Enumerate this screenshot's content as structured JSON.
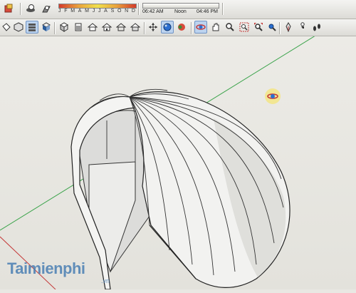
{
  "toolbar_shadows": {
    "months": [
      "J",
      "F",
      "M",
      "A",
      "M",
      "J",
      "J",
      "A",
      "S",
      "O",
      "N",
      "D"
    ],
    "time_start": "06:42 AM",
    "time_mid": "Noon",
    "time_end": "04:46 PM"
  },
  "toolbar_views": {
    "buttons": [
      "paint-bucket-icon",
      "iso-view-icon",
      "top-view-icon",
      "front-view-icon",
      "right-view-icon",
      "back-view-icon",
      "left-view-icon",
      "house-icon",
      "xray-icon",
      "wireframe-icon",
      "hidden-line-icon",
      "shaded-icon",
      "textured-icon",
      "orbit-icon",
      "pan-icon",
      "zoom-icon",
      "zoom-window-icon",
      "zoom-extents-icon",
      "previous-view-icon",
      "position-camera-icon",
      "walk-icon"
    ]
  },
  "watermark": {
    "text": "Taimienphi",
    "suffix": ".vn"
  },
  "colors": {
    "accent_active": "#bcd3ef",
    "axis_green": "#3aa34a",
    "axis_red": "#c43a3a",
    "watermark_blue": "#4a7fb3"
  }
}
